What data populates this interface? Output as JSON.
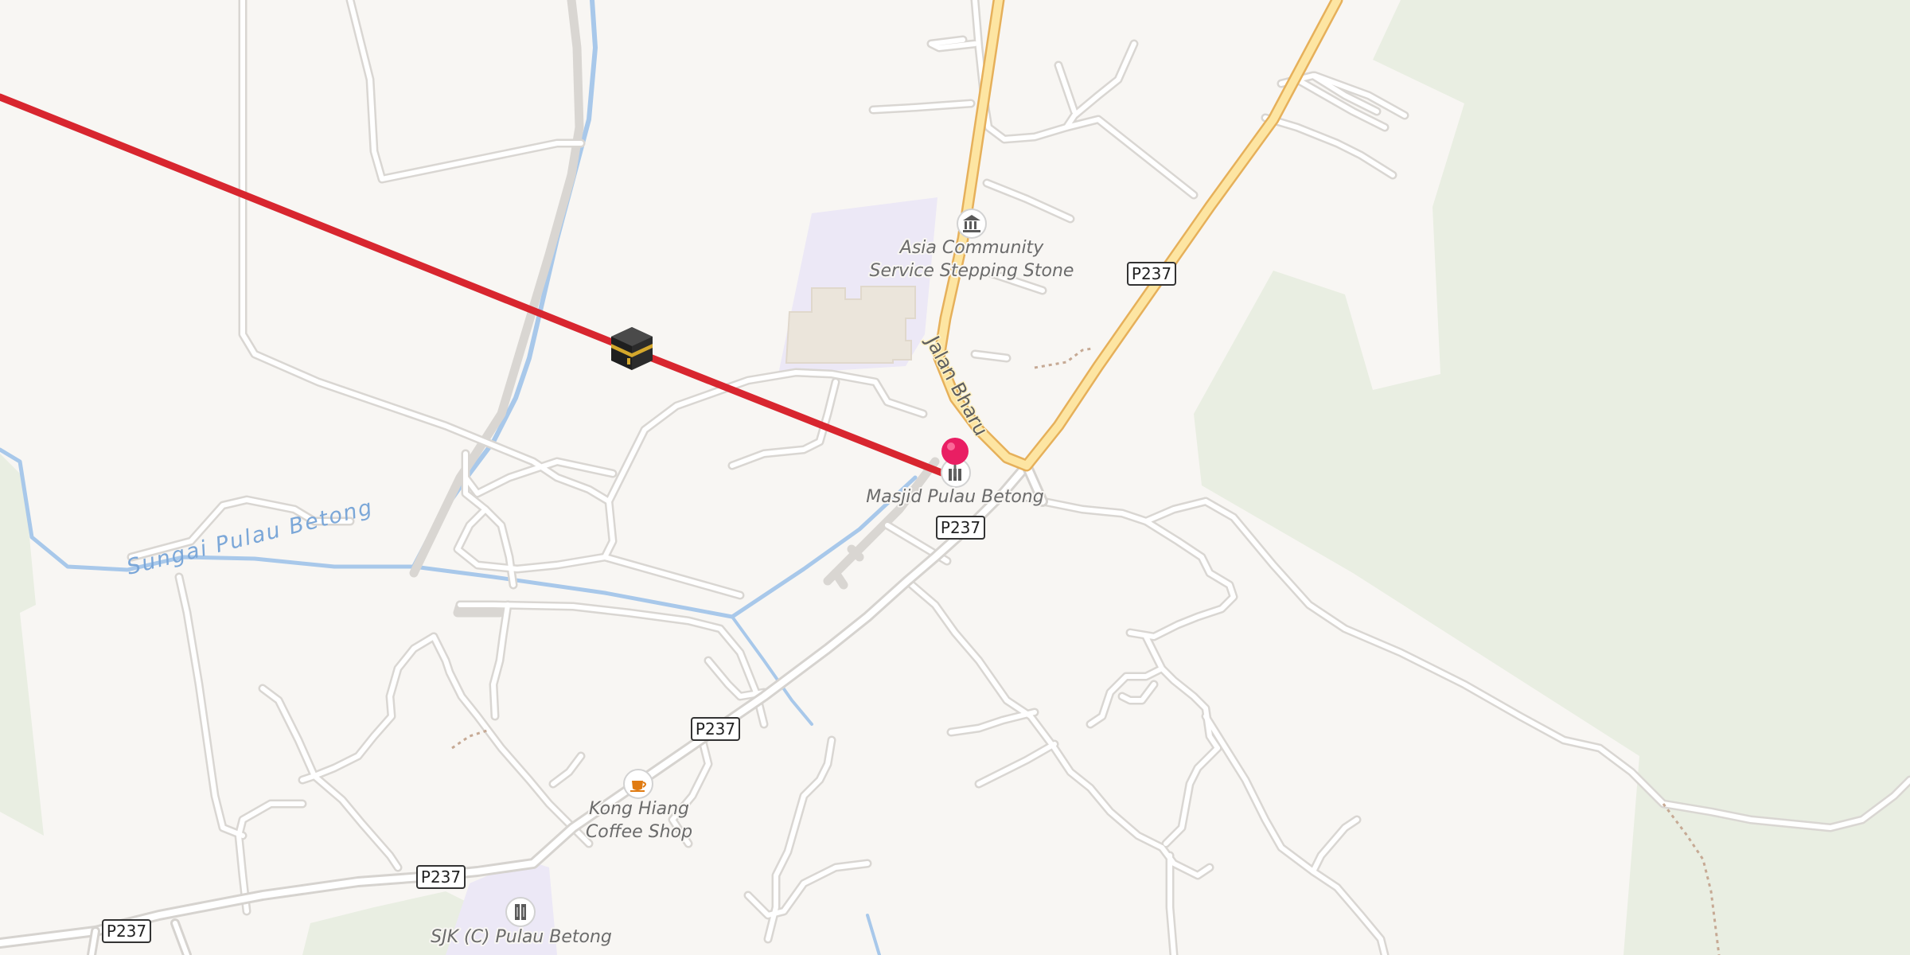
{
  "colors": {
    "land": "#f8f6f3",
    "forest": "#e9eee2",
    "road_casing": "#dcdad7",
    "road_fill": "#ffffff",
    "primary_casing": "#e8b35a",
    "primary_fill": "#fde5a2",
    "water": "#a8c8ea",
    "route": "#d8262f",
    "school_area": "#ece8f6",
    "building": "#ece7df",
    "marker": "#e91e63"
  },
  "pois": {
    "community": {
      "label_line1": "Asia Community",
      "label_line2": "Service Stepping Stone",
      "icon": "museum-icon"
    },
    "mosque": {
      "label": "Masjid Pulau Betong",
      "icon": "mosque-icon"
    },
    "coffee": {
      "label_line1": "Kong Hiang",
      "label_line2": "Coffee Shop",
      "icon": "cafe-icon"
    },
    "school": {
      "label": "SJK (C) Pulau Betong",
      "icon": "school-icon"
    }
  },
  "streets": {
    "jalan_bharu": "Jalan Bharu"
  },
  "water": {
    "river": "Sungai Pulau Betong"
  },
  "shields": {
    "p237_a": "P237",
    "p237_b": "P237",
    "p237_c": "P237",
    "p237_d": "P237",
    "p237_e": "P237"
  },
  "markers": {
    "destination": "map-pin-icon",
    "qibla": "kaaba-icon"
  }
}
